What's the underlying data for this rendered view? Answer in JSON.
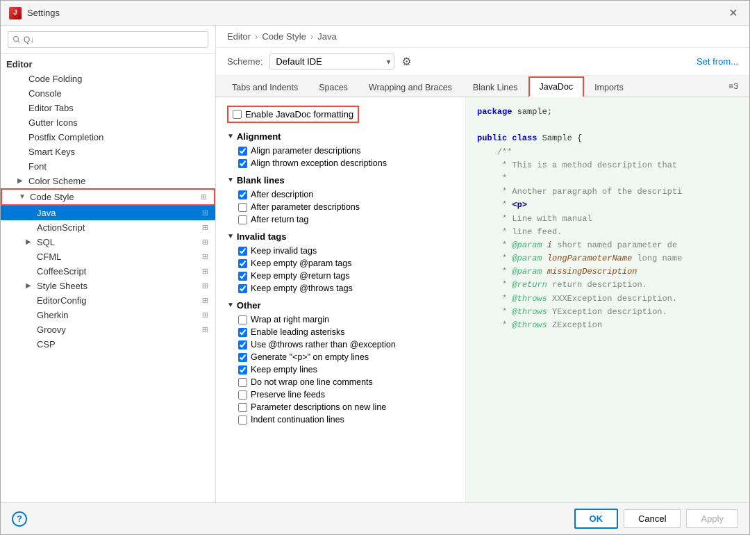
{
  "window": {
    "title": "Settings",
    "close_label": "✕"
  },
  "search": {
    "placeholder": "Q↓"
  },
  "breadcrumb": {
    "parts": [
      "Editor",
      "Code Style",
      "Java"
    ],
    "sep": "›"
  },
  "scheme": {
    "label": "Scheme:",
    "value": "Default  IDE",
    "set_from": "Set from..."
  },
  "tabs": [
    {
      "id": "tabs-indents",
      "label": "Tabs and Indents"
    },
    {
      "id": "spaces",
      "label": "Spaces"
    },
    {
      "id": "wrapping",
      "label": "Wrapping and Braces"
    },
    {
      "id": "blank-lines",
      "label": "Blank Lines"
    },
    {
      "id": "javadoc",
      "label": "JavaDoc",
      "active": true,
      "highlighted": true
    },
    {
      "id": "imports",
      "label": "Imports"
    }
  ],
  "tabs_more": "≡3",
  "settings": {
    "enable_label": "Enable JavaDoc formatting",
    "alignment_section": "Alignment",
    "alignment_options": [
      {
        "label": "Align parameter descriptions",
        "checked": true
      },
      {
        "label": "Align thrown exception descriptions",
        "checked": true
      }
    ],
    "blank_lines_section": "Blank lines",
    "blank_lines_options": [
      {
        "label": "After description",
        "checked": true
      },
      {
        "label": "After parameter descriptions",
        "checked": false
      },
      {
        "label": "After return tag",
        "checked": false
      }
    ],
    "invalid_tags_section": "Invalid tags",
    "invalid_tags_options": [
      {
        "label": "Keep invalid tags",
        "checked": true
      },
      {
        "label": "Keep empty @param tags",
        "checked": true
      },
      {
        "label": "Keep empty @return tags",
        "checked": true
      },
      {
        "label": "Keep empty @throws tags",
        "checked": true
      }
    ],
    "other_section": "Other",
    "other_options": [
      {
        "label": "Wrap at right margin",
        "checked": false
      },
      {
        "label": "Enable leading asterisks",
        "checked": true
      },
      {
        "label": "Use @throws rather than @exception",
        "checked": true
      },
      {
        "label": "Generate \"<p>\" on empty lines",
        "checked": true
      },
      {
        "label": "Keep empty lines",
        "checked": true
      },
      {
        "label": "Do not wrap one line comments",
        "checked": false
      },
      {
        "label": "Preserve line feeds",
        "checked": false
      },
      {
        "label": "Parameter descriptions on new line",
        "checked": false
      },
      {
        "label": "Indent continuation lines",
        "checked": false
      }
    ]
  },
  "sidebar": {
    "editor_label": "Editor",
    "items": [
      {
        "id": "code-folding",
        "label": "Code Folding",
        "level": 1
      },
      {
        "id": "console",
        "label": "Console",
        "level": 1
      },
      {
        "id": "editor-tabs",
        "label": "Editor Tabs",
        "level": 1
      },
      {
        "id": "gutter-icons",
        "label": "Gutter Icons",
        "level": 1
      },
      {
        "id": "postfix",
        "label": "Postfix Completion",
        "level": 1
      },
      {
        "id": "smart-keys",
        "label": "Smart Keys",
        "level": 1
      },
      {
        "id": "font",
        "label": "Font",
        "level": 1
      },
      {
        "id": "color-scheme",
        "label": "Color Scheme",
        "level": 1,
        "expandable": true
      },
      {
        "id": "code-style",
        "label": "Code Style",
        "level": 1,
        "expanded": true,
        "expandable": true,
        "highlighted": true
      },
      {
        "id": "java",
        "label": "Java",
        "level": 2,
        "selected": true
      },
      {
        "id": "actionscript",
        "label": "ActionScript",
        "level": 2
      },
      {
        "id": "sql",
        "label": "SQL",
        "level": 2,
        "expandable": true
      },
      {
        "id": "cfml",
        "label": "CFML",
        "level": 2
      },
      {
        "id": "coffeescript",
        "label": "CoffeeScript",
        "level": 2
      },
      {
        "id": "style-sheets",
        "label": "Style Sheets",
        "level": 2,
        "expandable": true
      },
      {
        "id": "editorconfig",
        "label": "EditorConfig",
        "level": 2
      },
      {
        "id": "gherkin",
        "label": "Gherkin",
        "level": 2
      },
      {
        "id": "groovy",
        "label": "Groovy",
        "level": 2
      },
      {
        "id": "csp",
        "label": "CSP",
        "level": 2
      }
    ]
  },
  "buttons": {
    "ok": "OK",
    "cancel": "Cancel",
    "apply": "Apply",
    "help": "?"
  },
  "code_preview": {
    "lines": [
      "package sample;",
      "",
      "public class Sample {",
      "    /**",
      "     * This is a method description that",
      "     *",
      "     * Another paragraph of the descripti",
      "     * <p>",
      "     * Line with manual",
      "     * line feed.",
      "     * @param i short named parameter de",
      "     * @param longParameterName long name",
      "     * @param missingDescription",
      "     * @return return description.",
      "     * @throws XXXException description.",
      "     * @throws YException description.",
      "     * @throws ZException"
    ]
  }
}
